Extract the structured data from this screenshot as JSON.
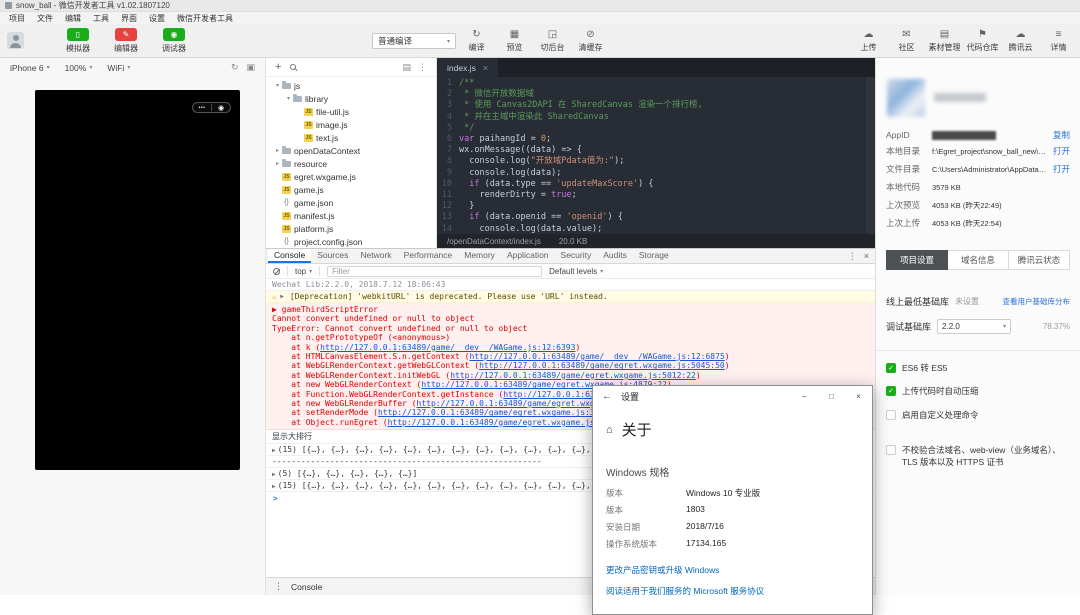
{
  "colors": {
    "wx_green": "#1aad19",
    "wx_red": "#e64340",
    "link_blue": "#2a6fd6",
    "error_red": "#e00000",
    "warn_bg": "#fffbe5",
    "error_bg": "#fff0f0",
    "active_tab_blue": "#1a73e8",
    "win_link": "#0067c0"
  },
  "icons": {
    "caret": "▾",
    "close": "×",
    "kebab": "⋮",
    "collapse": "▤",
    "plus": "+",
    "rotate": "↻",
    "dock": "▣",
    "dots": "•••",
    "target": "◉",
    "warning": "⚠",
    "expand": "▶",
    "back": "←",
    "home": "⌂",
    "minimize": "–",
    "maximize": "□"
  },
  "titlebar": {
    "title": "snow_ball - 微信开发者工具 v1.02.1807120"
  },
  "menubar": {
    "items": [
      "项目",
      "文件",
      "编辑",
      "工具",
      "界面",
      "设置",
      "微信开发者工具"
    ]
  },
  "toolbar": {
    "toggles": [
      {
        "id": "simulator",
        "label": "模拟器",
        "glyph": "▯",
        "color": "#1aad19"
      },
      {
        "id": "editor",
        "label": "编辑器",
        "glyph": "✎",
        "color": "#e64340"
      },
      {
        "id": "debugger",
        "label": "调试器",
        "glyph": "◉",
        "color": "#1aad19"
      }
    ],
    "compile_mode": "普通编译",
    "actions_center": [
      {
        "id": "compile",
        "label": "编译",
        "glyph": "↻"
      },
      {
        "id": "preview",
        "label": "预览",
        "glyph": "▦"
      },
      {
        "id": "background",
        "label": "切后台",
        "glyph": "◲"
      },
      {
        "id": "clear-cache",
        "label": "清缓存",
        "glyph": "⊘"
      }
    ],
    "actions_right": [
      {
        "id": "upload",
        "label": "上传",
        "glyph": "☁"
      },
      {
        "id": "community",
        "label": "社区",
        "glyph": "✉"
      },
      {
        "id": "assets",
        "label": "素材管理",
        "glyph": "▤"
      },
      {
        "id": "repo",
        "label": "代码仓库",
        "glyph": "⚑"
      },
      {
        "id": "tencent-cloud",
        "label": "腾讯云",
        "glyph": "☁"
      },
      {
        "id": "details",
        "label": "详情",
        "glyph": "≡"
      }
    ]
  },
  "simulator": {
    "device": "iPhone 6",
    "zoom": "100%",
    "network": "WiFi"
  },
  "file_tree": {
    "items": [
      {
        "depth": 0,
        "type": "folder",
        "expanded": true,
        "name": "js"
      },
      {
        "depth": 1,
        "type": "folder",
        "expanded": true,
        "name": "library"
      },
      {
        "depth": 2,
        "type": "js",
        "name": "file-util.js"
      },
      {
        "depth": 2,
        "type": "js",
        "name": "image.js"
      },
      {
        "depth": 2,
        "type": "js",
        "name": "text.js"
      },
      {
        "depth": 0,
        "type": "folder",
        "expanded": false,
        "name": "openDataContext"
      },
      {
        "depth": 0,
        "type": "folder",
        "expanded": false,
        "name": "resource"
      },
      {
        "depth": 0,
        "type": "js",
        "name": "egret.wxgame.js"
      },
      {
        "depth": 0,
        "type": "js",
        "name": "game.js"
      },
      {
        "depth": 0,
        "type": "json",
        "name": "game.json"
      },
      {
        "depth": 0,
        "type": "js",
        "name": "manifest.js"
      },
      {
        "depth": 0,
        "type": "js",
        "name": "platform.js"
      },
      {
        "depth": 0,
        "type": "json",
        "name": "project.config.json"
      }
    ]
  },
  "editor": {
    "tab": "index.js",
    "code": [
      {
        "n": 1,
        "segs": [
          {
            "t": "/**",
            "c": "comment"
          }
        ]
      },
      {
        "n": 2,
        "segs": [
          {
            "t": " * 微信开放数据域",
            "c": "comment"
          }
        ]
      },
      {
        "n": 3,
        "segs": [
          {
            "t": " * 使用 Canvas2DAPI 在 SharedCanvas 渲染一个排行榜,",
            "c": "comment"
          }
        ]
      },
      {
        "n": 4,
        "segs": [
          {
            "t": " * 并在主域中渲染此 SharedCanvas",
            "c": "comment"
          }
        ]
      },
      {
        "n": 5,
        "segs": [
          {
            "t": " */",
            "c": "comment"
          }
        ]
      },
      {
        "n": 6,
        "segs": [
          {
            "t": "var",
            "c": "keyword"
          },
          {
            "t": " paihangId = ",
            "c": "plain"
          },
          {
            "t": "0",
            "c": "number"
          },
          {
            "t": ";",
            "c": "plain"
          }
        ]
      },
      {
        "n": 7,
        "segs": [
          {
            "t": "wx.onMessage((data) => {",
            "c": "plain"
          }
        ]
      },
      {
        "n": 8,
        "segs": [
          {
            "t": "  console.log(",
            "c": "plain"
          },
          {
            "t": "\"开放域Pdata值为:\"",
            "c": "string"
          },
          {
            "t": ");",
            "c": "plain"
          }
        ]
      },
      {
        "n": 9,
        "segs": [
          {
            "t": "  console.log(data);",
            "c": "plain"
          }
        ]
      },
      {
        "n": 10,
        "segs": [
          {
            "t": "  ",
            "c": "plain"
          },
          {
            "t": "if",
            "c": "keyword"
          },
          {
            "t": " (data.type == ",
            "c": "plain"
          },
          {
            "t": "'updateMaxScore'",
            "c": "string"
          },
          {
            "t": ") {",
            "c": "plain"
          }
        ]
      },
      {
        "n": 11,
        "segs": [
          {
            "t": "    renderDirty = ",
            "c": "plain"
          },
          {
            "t": "true",
            "c": "keyword"
          },
          {
            "t": ";",
            "c": "plain"
          }
        ]
      },
      {
        "n": 12,
        "segs": [
          {
            "t": "  }",
            "c": "plain"
          }
        ]
      },
      {
        "n": 13,
        "segs": [
          {
            "t": "  ",
            "c": "plain"
          },
          {
            "t": "if",
            "c": "keyword"
          },
          {
            "t": " (data.openid == ",
            "c": "plain"
          },
          {
            "t": "'openid'",
            "c": "string"
          },
          {
            "t": ") {",
            "c": "plain"
          }
        ]
      },
      {
        "n": 14,
        "segs": [
          {
            "t": "    console.log(data.value);",
            "c": "plain"
          }
        ]
      }
    ],
    "statusbar": {
      "path": "/openDataContext/index.js",
      "size": "20.0 KB"
    }
  },
  "devtools": {
    "tabs": [
      {
        "label": "Console",
        "active": true
      },
      {
        "label": "Sources"
      },
      {
        "label": "Network"
      },
      {
        "label": "Performance"
      },
      {
        "label": "Memory"
      },
      {
        "label": "Application"
      },
      {
        "label": "Security"
      },
      {
        "label": "Audits"
      },
      {
        "label": "Storage"
      }
    ],
    "toolbar": {
      "context": "top",
      "filter_placeholder": "Filter",
      "levels": "Default levels"
    },
    "drawer_label": "Console",
    "console": {
      "prompt": ">",
      "messages": [
        {
          "type": "info",
          "text": "Wechat Lib:2.2.0, 2018.7.12 18:06:43"
        },
        {
          "type": "warning",
          "text": "[Deprecation] 'webkitURL' is deprecated. Please use 'URL' instead."
        },
        {
          "type": "error",
          "lines": [
            [
              {
                "t": "▶ gameThirdScriptError",
                "c": "plain"
              }
            ],
            [
              {
                "t": "Cannot convert undefined or null to object",
                "c": "plain"
              }
            ],
            [
              {
                "t": "TypeError: Cannot convert undefined or null to object",
                "c": "plain"
              }
            ],
            [
              {
                "t": "    at n.getPrototypeOf (<anonymous>)",
                "c": "plain"
              }
            ],
            [
              {
                "t": "    at k (",
                "c": "plain"
              },
              {
                "t": "http://127.0.0.1:63489/game/__dev__/WAGame.js:12:6393",
                "c": "link"
              },
              {
                "t": ")",
                "c": "plain"
              }
            ],
            [
              {
                "t": "    at HTMLCanvasElement.S.n.getContext (",
                "c": "plain"
              },
              {
                "t": "http://127.0.0.1:63489/game/__dev__/WAGame.js:12:6875",
                "c": "link"
              },
              {
                "t": ")",
                "c": "plain"
              }
            ],
            [
              {
                "t": "    at WebGLRenderContext.getWebGLContext (",
                "c": "plain"
              },
              {
                "t": "http://127.0.0.1:63489/game/egret.wxgame.js:5045:50",
                "c": "link"
              },
              {
                "t": ")",
                "c": "plain"
              }
            ],
            [
              {
                "t": "    at WebGLRenderContext.initWebGL (",
                "c": "plain"
              },
              {
                "t": "http://127.0.0.1:63489/game/egret.wxgame.js:5012:22",
                "c": "link"
              },
              {
                "t": ")",
                "c": "plain"
              }
            ],
            [
              {
                "t": "    at new WebGLRenderContext (",
                "c": "plain"
              },
              {
                "t": "http://127.0.0.1:63489/game/egret.wxgame.js:4879:22",
                "c": "link"
              },
              {
                "t": ")",
                "c": "plain"
              }
            ],
            [
              {
                "t": "    at Function.WebGLRenderContext.getInstance (",
                "c": "plain"
              },
              {
                "t": "http://127.0.0.1:63489/game/egret.wxgame.js:4894:33",
                "c": "link"
              },
              {
                "t": ")",
                "c": "plain"
              }
            ],
            [
              {
                "t": "    at new WebGLRenderBuffer (",
                "c": "plain"
              },
              {
                "t": "http://127.0.0.1:63489/game/egret.wxgame.js:5758:59",
                "c": "link"
              },
              {
                "t": ")",
                "c": "plain"
              }
            ],
            [
              {
                "t": "    at setRenderMode (",
                "c": "plain"
              },
              {
                "t": "http://127.0.0.1:63489/game/egret.wxgame.js:3046:49",
                "c": "link"
              },
              {
                "t": ")",
                "c": "plain"
              }
            ],
            [
              {
                "t": "    at Object.runEgret (",
                "c": "plain"
              },
              {
                "t": "http://127.0.0.1:63489/game/egret.wxgame.js:3000:13",
                "c": "link"
              },
              {
                "t": ")",
                "c": "plain"
              }
            ]
          ]
        },
        {
          "type": "log",
          "text": "显示大排行"
        },
        {
          "type": "array",
          "text": "(15) [{…}, {…}, {…}, {…}, {…}, {…}, {…}, {…}, {…}, {…}, {…}, {…}, {…}, {…}, {…}]"
        },
        {
          "type": "log",
          "text": "--------------------------------------------------------"
        },
        {
          "type": "array",
          "text": "(5) [{…}, {…}, {…}, {…}, {…}]"
        },
        {
          "type": "array",
          "text": "(15) [{…}, {…}, {…}, {…}, {…}, {…}, {…}, {…}, {…}, {…}, {…}, {…}, {…}, {…}, {…}]"
        }
      ]
    }
  },
  "project_panel": {
    "appid_label": "AppID",
    "copy_label": "复制",
    "info_rows": [
      {
        "label": "本地目录",
        "value": "f:\\Egret_project\\snow_ball_new\\2018.07...",
        "action": "打开"
      },
      {
        "label": "文件目录",
        "value": "C:\\Users\\Administrator\\AppData\\Local...",
        "action": "打开"
      },
      {
        "label": "本地代码",
        "value": "3579 KB"
      },
      {
        "label": "上次预览",
        "value": "4053 KB (昨天22:49)"
      },
      {
        "label": "上次上传",
        "value": "4053 KB (昨天22:54)"
      }
    ],
    "tabs": [
      {
        "label": "项目设置",
        "active": true
      },
      {
        "label": "域名信息"
      },
      {
        "label": "腾讯云状态"
      }
    ],
    "base_lib": {
      "label": "线上最低基础库",
      "value": "未设置",
      "link": "查看用户基础库分布"
    },
    "debug_lib": {
      "label": "调试基础库",
      "value": "2.2.0",
      "percent": "78.37%"
    },
    "checkboxes": [
      {
        "label": "ES6 转 ES5",
        "checked": true
      },
      {
        "label": "上传代码时自动压缩",
        "checked": true
      },
      {
        "label": "启用自定义处理命令",
        "checked": false
      },
      {
        "label": "不校验合法域名、web-view（业务域名）、TLS 版本以及 HTTPS 证书",
        "checked": false
      }
    ]
  },
  "settings_dialog": {
    "back_title": "设置",
    "page_title": "关于",
    "section": "Windows 规格",
    "rows": [
      {
        "label": "版本",
        "value": "Windows 10 专业版"
      },
      {
        "label": "版本",
        "value": "1803"
      },
      {
        "label": "安装日期",
        "value": "2018/7/16"
      },
      {
        "label": "操作系统版本",
        "value": "17134.165"
      }
    ],
    "links": [
      "更改产品密钥或升级 Windows",
      "阅读适用于我们服务的 Microsoft 服务协议"
    ]
  }
}
